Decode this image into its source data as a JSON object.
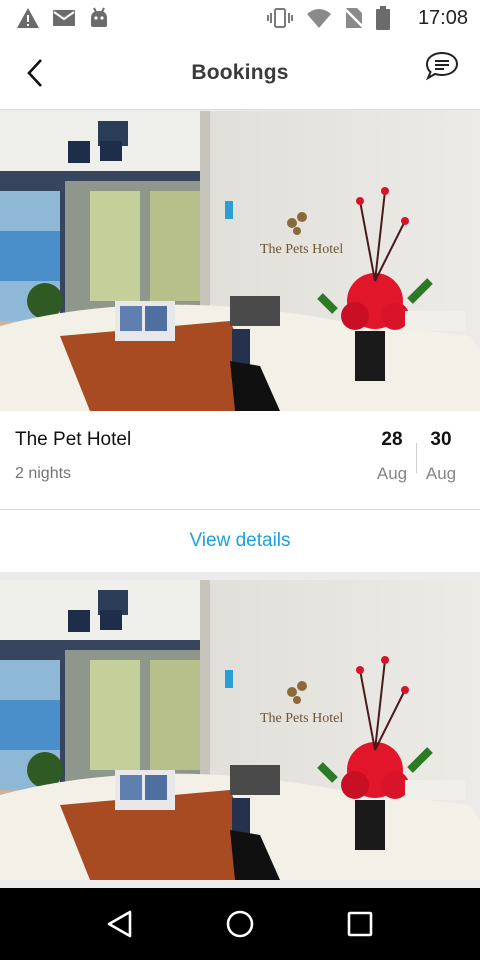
{
  "status_bar": {
    "time": "17:08",
    "icons": [
      "warning-icon",
      "mail-icon",
      "android-icon",
      "vibrate-icon",
      "wifi-icon",
      "no-sim-icon",
      "battery-icon"
    ]
  },
  "app_bar": {
    "title": "Bookings",
    "back_icon": "back-arrow-icon",
    "chat_icon": "chat-bubble-icon"
  },
  "bookings": [
    {
      "image": "hotel-reception-photo",
      "sign_text": "The Pets Hotel",
      "hotel_name": "The Pet Hotel",
      "nights": "2 nights",
      "check_in": {
        "day": "28",
        "month": "Aug"
      },
      "check_out": {
        "day": "30",
        "month": "Aug"
      },
      "action_label": "View details"
    },
    {
      "image": "hotel-reception-photo",
      "sign_text": "The Pets Hotel"
    }
  ],
  "nav_bar": {
    "buttons": [
      "back-triangle-icon",
      "home-circle-icon",
      "recents-square-icon"
    ]
  },
  "colors": {
    "accent": "#1ba0e2",
    "nav_bar": "#000000",
    "divider": "#d6d6d6"
  }
}
